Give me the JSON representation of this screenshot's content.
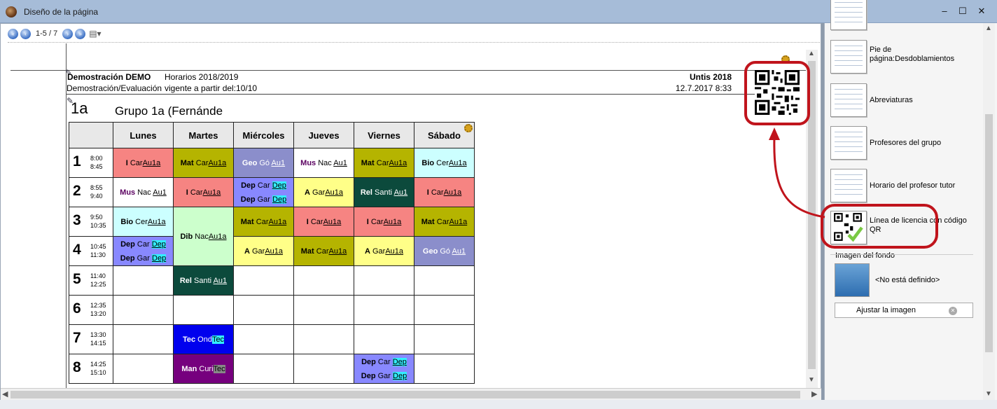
{
  "window": {
    "title": "Diseño de la página",
    "minimize": "–",
    "maximize": "☐",
    "close": "✕"
  },
  "toolbar": {
    "page_label": "1-5 / 7",
    "first": "«",
    "prev": "‹",
    "next": "›",
    "last": "»",
    "doc_icon": "▤▾"
  },
  "header": {
    "school": "Demostración  DEMO",
    "evaluation": "Demostración/Evaluación",
    "year": "Horarios 2018/2019",
    "valid_from": "vigente a partir del:10/10",
    "untis": "Untis 2018",
    "print_date": "12.7.2017  8:33"
  },
  "class": {
    "code": "1a",
    "title": "Grupo 1a (Fernánde"
  },
  "timetable": {
    "days": [
      "Lunes",
      "Martes",
      "Miércoles",
      "Jueves",
      "Viernes",
      "Sábado"
    ],
    "periods": [
      {
        "num": "1",
        "start": "8:00",
        "end": "8:45"
      },
      {
        "num": "2",
        "start": "8:55",
        "end": "9:40"
      },
      {
        "num": "3",
        "start": "9:50",
        "end": "10:35"
      },
      {
        "num": "4",
        "start": "10:45",
        "end": "11:30"
      },
      {
        "num": "5",
        "start": "11:40",
        "end": "12:25"
      },
      {
        "num": "6",
        "start": "12:35",
        "end": "13:20"
      },
      {
        "num": "7",
        "start": "13:30",
        "end": "14:15"
      },
      {
        "num": "8",
        "start": "14:25",
        "end": "15:10"
      }
    ]
  },
  "lessons": {
    "p1": [
      {
        "subject": "I",
        "teacher": "Car",
        "room": "Au1a"
      },
      {
        "subject": "Mat",
        "teacher": "Car",
        "room": "Au1a"
      },
      {
        "subject": "Geo",
        "teacher": "Gó",
        "room": "Au1"
      },
      {
        "subject": "Mus",
        "teacher": "Nac",
        "room": "Au1"
      },
      {
        "subject": "Mat",
        "teacher": "Car",
        "room": "Au1a"
      },
      {
        "subject": "Bio",
        "teacher": "Cer",
        "room": "Au1a"
      }
    ],
    "p2": [
      {
        "subject": "Mus",
        "teacher": "Nac",
        "room": "Au1"
      },
      {
        "subject": "I",
        "teacher": "Car",
        "room": "Au1a"
      },
      {
        "subject": "Dep",
        "teacher": "Car",
        "room": "Dep",
        "subject2": "Dep",
        "teacher2": "Gar",
        "room2": "Dep"
      },
      {
        "subject": "A",
        "teacher": "Gar",
        "room": "Au1a"
      },
      {
        "subject": "Rel",
        "teacher": "Santi",
        "room": "Au1"
      },
      {
        "subject": "I",
        "teacher": "Car",
        "room": "Au1a"
      }
    ],
    "p3": [
      {
        "subject": "Bio",
        "teacher": "Cer",
        "room": "Au1a"
      },
      {
        "subject": "Dib",
        "teacher": "Nac",
        "room": "Au1a"
      },
      {
        "subject": "Mat",
        "teacher": "Car",
        "room": "Au1a"
      },
      {
        "subject": "I",
        "teacher": "Car",
        "room": "Au1a"
      },
      {
        "subject": "I",
        "teacher": "Car",
        "room": "Au1a"
      },
      {
        "subject": "Mat",
        "teacher": "Car",
        "room": "Au1a"
      }
    ],
    "p4": [
      {
        "subject": "Dep",
        "teacher": "Car",
        "room": "Dep",
        "subject2": "Dep",
        "teacher2": "Gar",
        "room2": "Dep"
      },
      {
        "subject": "A",
        "teacher": "Gar",
        "room": "Au1a"
      },
      {
        "subject": "Mat",
        "teacher": "Car",
        "room": "Au1a"
      },
      {
        "subject": "A",
        "teacher": "Gar",
        "room": "Au1a"
      },
      {
        "subject": "Geo",
        "teacher": "Gó",
        "room": "Au1"
      }
    ],
    "p5": {
      "subject": "Rel",
      "teacher": "Santi",
      "room": "Au1"
    },
    "p7": {
      "subject": "Tec",
      "teacher": "Ond",
      "room": "Tec"
    },
    "p8_tue": {
      "subject": "Man",
      "teacher": "Curi",
      "room": "Tec"
    },
    "p8_fri": {
      "subject": "Dep",
      "teacher": "Car",
      "room": "Dep",
      "subject2": "Dep",
      "teacher2": "Gar",
      "room2": "Dep"
    }
  },
  "right_pane": {
    "items": [
      {
        "label": "Pie de página:Desdoblamientos"
      },
      {
        "label": "Abreviaturas"
      },
      {
        "label": "Profesores del grupo"
      },
      {
        "label": "Horario del profesor tutor"
      },
      {
        "label": "Línea de licencia con código QR"
      }
    ],
    "background_label": "Imagen del fondo",
    "background_value": "<No está definido>",
    "adjust_button": "Ajustar la imagen"
  },
  "colors": {
    "callout": "#c0141c",
    "titlebar": "#a6bcd8"
  }
}
